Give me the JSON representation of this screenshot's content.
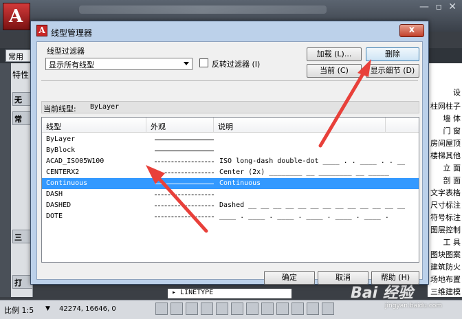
{
  "app": {
    "logo_letter": "A",
    "window_controls": [
      "—",
      "▫",
      "✕"
    ],
    "tab_common": "常用",
    "panel_labels": [
      "特性",
      "无",
      "常",
      "三",
      "打"
    ],
    "right_panel_items": [
      "设",
      "柱网柱子",
      "墙 体",
      "门 窗",
      "房间屋顶",
      "楼梯其他",
      "立 面",
      "剖 面",
      "文字表格",
      "尺寸标注",
      "符号标注",
      "图层控制",
      "工 具",
      "图块图案",
      "建筑防火",
      "场地布置",
      "三维建模"
    ],
    "command_line": "LINETYPE",
    "status": {
      "scale_label": "比例 1:5",
      "coords": "42274, 16646, 0"
    },
    "watermark": "Bai 经验",
    "watermark_sub": "jingyan.baidu.com"
  },
  "dialog": {
    "title": "线型管理器",
    "close_glyph": "x",
    "filter_group_label": "线型过滤器",
    "filter_select_value": "显示所有线型",
    "invert_filter_label": "反转过滤器 (I)",
    "buttons": {
      "load": "加载 (L)...",
      "delete": "删除",
      "current": "当前 (C)",
      "show_details": "显示细节 (D)",
      "ok": "确定",
      "cancel": "取消",
      "help": "帮助 (H)"
    },
    "current_linetype_label": "当前线型:",
    "current_linetype_value": "ByLayer",
    "columns": {
      "linetype": "线型",
      "appearance": "外观",
      "description": "说明"
    },
    "rows": [
      {
        "name": "ByLayer",
        "style": "solid",
        "description": ""
      },
      {
        "name": "ByBlock",
        "style": "solid",
        "description": ""
      },
      {
        "name": "ACAD_ISO05W100",
        "style": "dash",
        "description": "ISO long-dash double-dot ____ . . ____ . . __"
      },
      {
        "name": "CENTERX2",
        "style": "dash",
        "description": "Center (2x) ________ __ ________ __ _____"
      },
      {
        "name": "Continuous",
        "style": "solid",
        "description": "Continuous",
        "selected": true
      },
      {
        "name": "DASH",
        "style": "dash",
        "description": ""
      },
      {
        "name": "DASHED",
        "style": "dash",
        "description": "Dashed __ __ __ __ __ __ __ __ __ __ __ __ __"
      },
      {
        "name": "DOTE",
        "style": "dash",
        "description": "____ . ____ . ____ . ____ . ____ . ____ ."
      }
    ]
  },
  "colors": {
    "selection": "#3399ff",
    "annotation_arrow": "#e8403a"
  }
}
